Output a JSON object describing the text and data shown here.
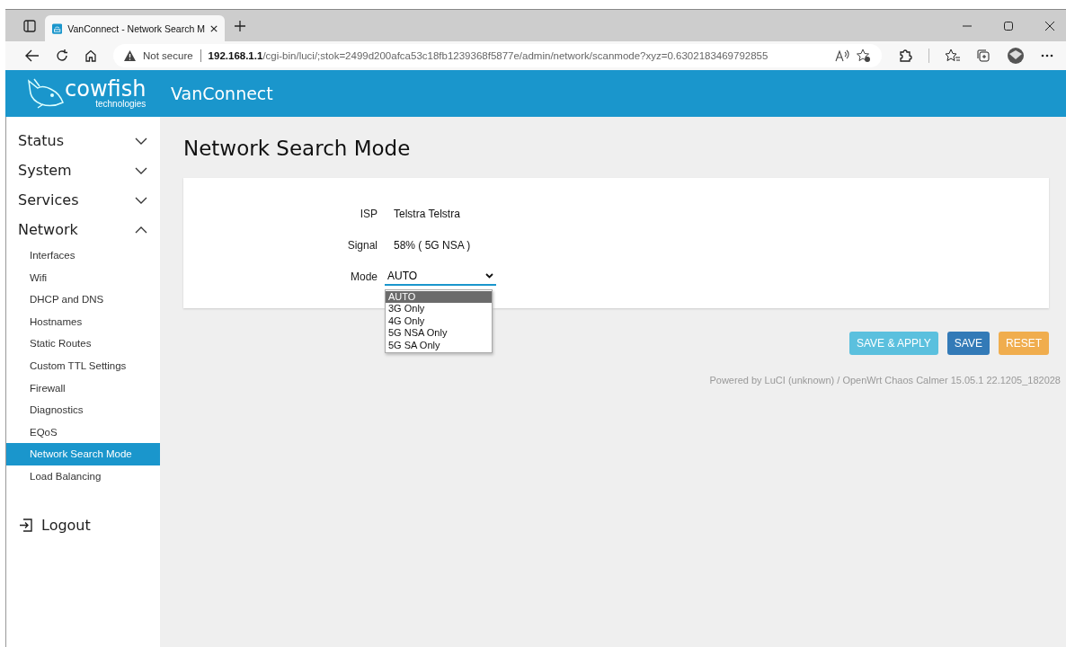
{
  "browser": {
    "tab_title": "VanConnect - Network Search M",
    "address": {
      "security": "Not secure",
      "host": "192.168.1.1",
      "path": "/cgi-bin/luci/;stok=2499d200afca53c18fb1239368f5877e/admin/network/scanmode?xyz=0.6302183469792855"
    }
  },
  "header": {
    "logo_word": "cowfish",
    "logo_sub": "technologies",
    "title": "VanConnect"
  },
  "sidebar": {
    "items": [
      {
        "label": "Status",
        "expanded": false
      },
      {
        "label": "System",
        "expanded": false
      },
      {
        "label": "Services",
        "expanded": false
      },
      {
        "label": "Network",
        "expanded": true,
        "children": [
          {
            "label": "Interfaces",
            "selected": false
          },
          {
            "label": "Wifi",
            "selected": false
          },
          {
            "label": "DHCP and DNS",
            "selected": false
          },
          {
            "label": "Hostnames",
            "selected": false
          },
          {
            "label": "Static Routes",
            "selected": false
          },
          {
            "label": "Custom TTL Settings",
            "selected": false
          },
          {
            "label": "Firewall",
            "selected": false
          },
          {
            "label": "Diagnostics",
            "selected": false
          },
          {
            "label": "EQoS",
            "selected": false
          },
          {
            "label": "Network Search Mode",
            "selected": true
          },
          {
            "label": "Load Balancing",
            "selected": false
          }
        ]
      }
    ],
    "logout": "Logout"
  },
  "page": {
    "title": "Network Search Mode",
    "fields": [
      {
        "label": "ISP",
        "value": "Telstra Telstra"
      },
      {
        "label": "Signal",
        "value": "58% ( 5G NSA )"
      }
    ],
    "mode": {
      "label": "Mode",
      "value": "AUTO",
      "options": [
        {
          "label": "AUTO",
          "selected": true
        },
        {
          "label": "3G Only",
          "selected": false
        },
        {
          "label": "4G Only",
          "selected": false
        },
        {
          "label": "5G NSA Only",
          "selected": false
        },
        {
          "label": "5G SA Only",
          "selected": false
        }
      ]
    },
    "buttons": [
      {
        "label": "SAVE & APPLY",
        "kind": "apply"
      },
      {
        "label": "SAVE",
        "kind": "save"
      },
      {
        "label": "RESET",
        "kind": "reset"
      }
    ],
    "footer": "Powered by LuCI (unknown) / OpenWrt Chaos Calmer 15.05.1 22.1205_182028"
  }
}
